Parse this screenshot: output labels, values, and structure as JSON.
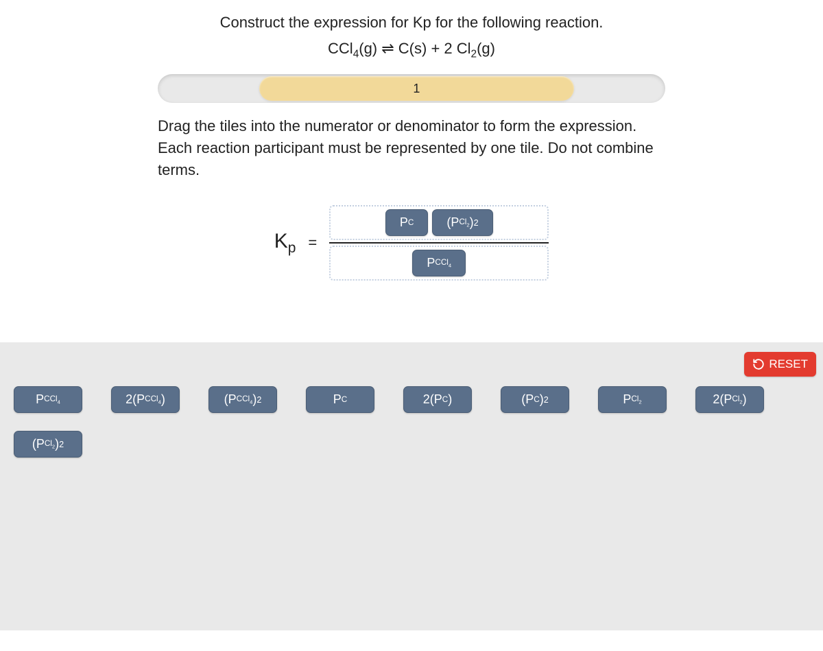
{
  "prompt": "Construct the expression for Kp for the following reaction.",
  "equation_html": "CCl<sub>4</sub>(g) ⇌ C(s) + 2 Cl<sub>2</sub>(g)",
  "progress": {
    "label": "1"
  },
  "instructions": "Drag the tiles into the numerator or denominator to form the expression. Each reaction participant must be represented by one tile. Do not combine terms.",
  "kp_label_html": "K<sub>p</sub>",
  "equals": "=",
  "numerator_tiles": [
    {
      "html": "P<sub>C</sub>"
    },
    {
      "html": "(P<sub>Cl<sub>2</sub></sub>)<sup>2</sup>"
    }
  ],
  "denominator_tiles": [
    {
      "html": "P<sub>CCl<sub>4</sub></sub>"
    }
  ],
  "reset_label": "RESET",
  "palette_tiles": [
    {
      "html": "P<sub>CCl<sub>4</sub></sub>"
    },
    {
      "html": "2(P<sub>CCl<sub>4</sub></sub>)"
    },
    {
      "html": "(P<sub>CCl<sub>4</sub></sub>)<sup>2</sup>"
    },
    {
      "html": "P<sub>C</sub>"
    },
    {
      "html": "2(P<sub>C</sub>)"
    },
    {
      "html": "(P<sub>C</sub>)<sup>2</sup>"
    },
    {
      "html": "P<sub>Cl<sub>2</sub></sub>"
    },
    {
      "html": "2(P<sub>Cl<sub>2</sub></sub>)"
    },
    {
      "html": "(P<sub>Cl<sub>2</sub></sub>)<sup>2</sup>"
    }
  ]
}
